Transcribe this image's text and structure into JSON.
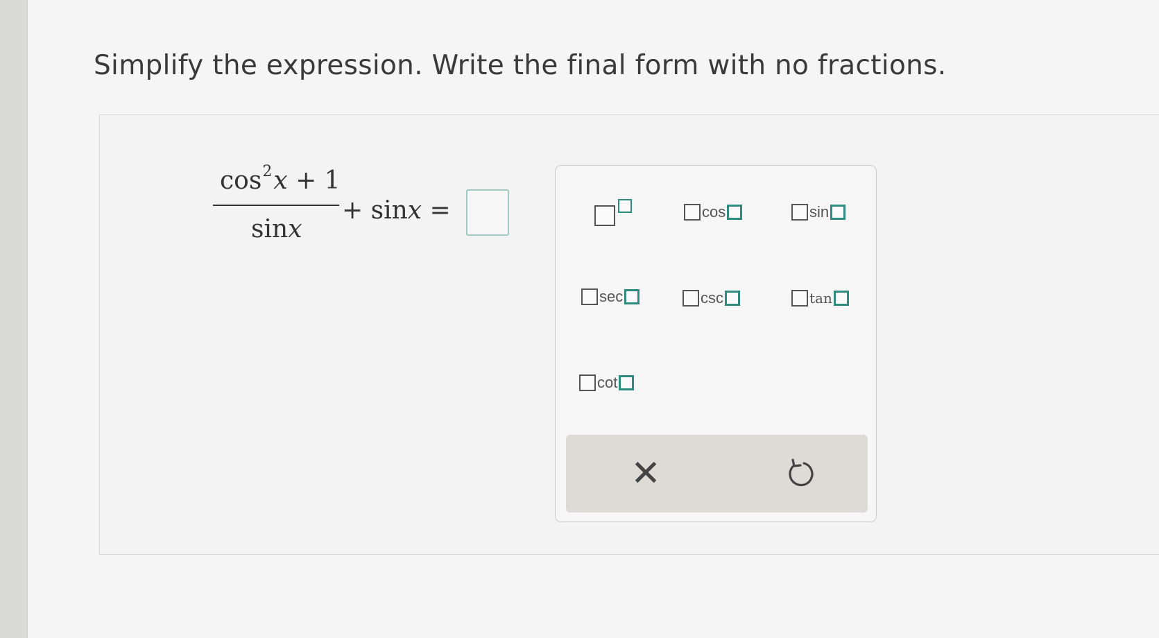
{
  "question": {
    "text": "Simplify the expression. Write the final form with no fractions."
  },
  "expression": {
    "numerator_func": "cos",
    "numerator_exp": "2",
    "numerator_var": "x",
    "numerator_rest": "+ 1",
    "denominator_func": "sin",
    "denominator_var": "x",
    "plus": "+ sin",
    "rest_var": "x",
    "equals": "="
  },
  "palette": {
    "keys": [
      {
        "name": "exponent-key",
        "label": ""
      },
      {
        "name": "cos-key",
        "label": "cos"
      },
      {
        "name": "sin-key",
        "label": "sin"
      },
      {
        "name": "sec-key",
        "label": "sec"
      },
      {
        "name": "csc-key",
        "label": "csc"
      },
      {
        "name": "tan-key",
        "label": "tan"
      },
      {
        "name": "cot-key",
        "label": "cot"
      }
    ],
    "clear_symbol": "✕"
  },
  "icons": {
    "clear": "close-icon",
    "undo": "undo-icon"
  },
  "colors": {
    "accent": "#2f8a80",
    "answer_box_border": "#9fc9c2"
  }
}
